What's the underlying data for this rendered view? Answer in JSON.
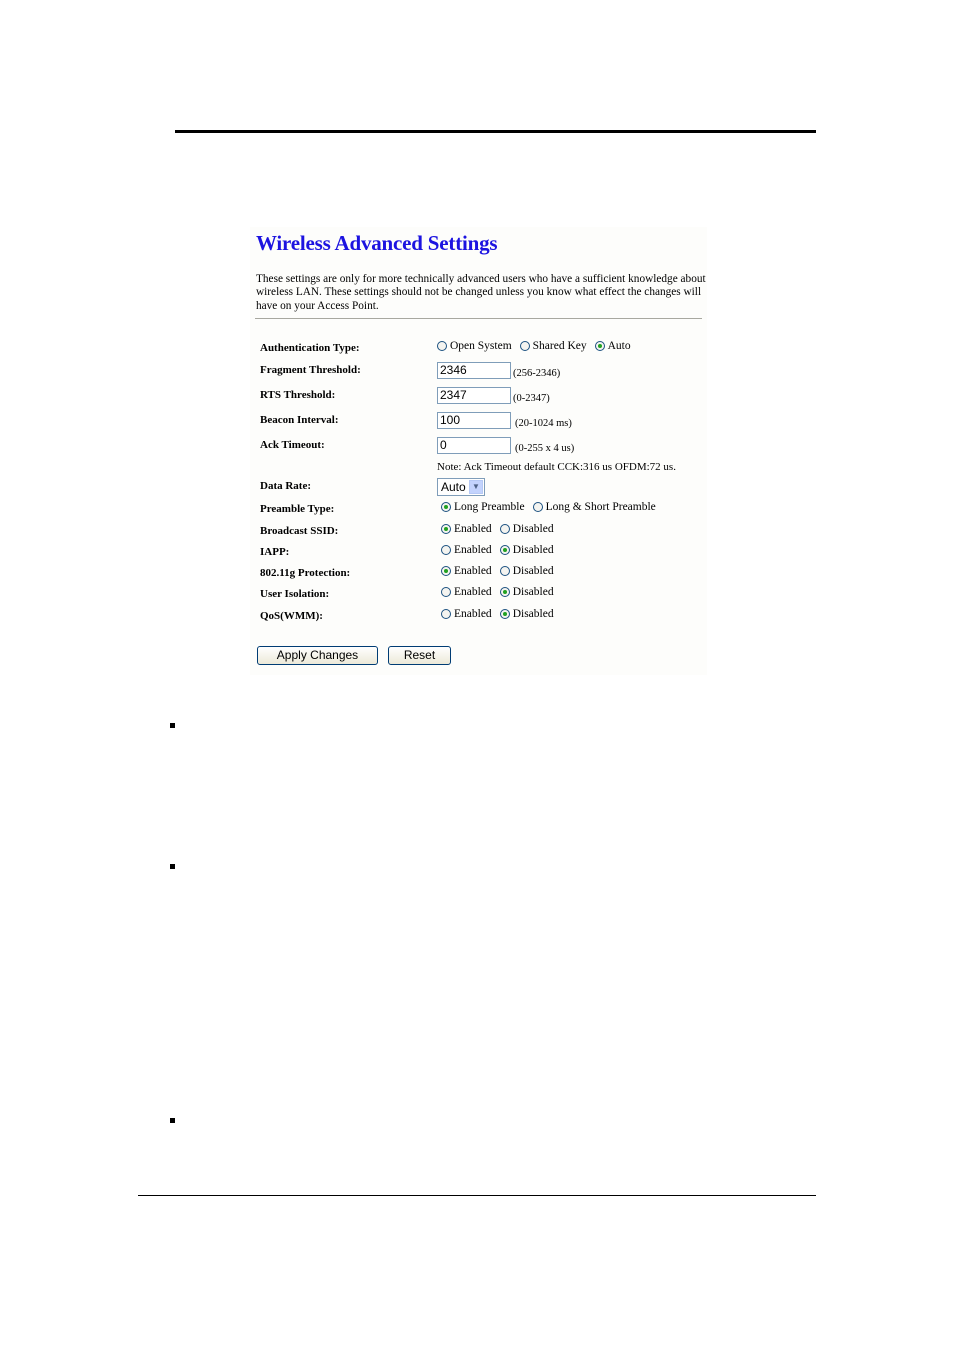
{
  "panel": {
    "title": "Wireless Advanced Settings",
    "intro": "These settings are only for more technically advanced users who have a sufficient knowledge about wireless LAN. These settings should not be changed unless you know what effect the changes will have on your Access Point.",
    "auth": {
      "label": "Authentication Type:",
      "options": [
        "Open System",
        "Shared Key",
        "Auto"
      ],
      "selected": "Auto"
    },
    "fragment": {
      "label": "Fragment Threshold:",
      "value": "2346",
      "hint": "(256-2346)"
    },
    "rts": {
      "label": "RTS Threshold:",
      "value": "2347",
      "hint": "(0-2347)"
    },
    "beacon": {
      "label": "Beacon Interval:",
      "value": "100",
      "hint": "(20-1024 ms)"
    },
    "ack": {
      "label": "Ack Timeout:",
      "value": "0",
      "hint": "(0-255 x 4 us)"
    },
    "ack_note": "Note: Ack Timeout default CCK:316 us OFDM:72 us.",
    "data_rate": {
      "label": "Data Rate:",
      "value": "Auto"
    },
    "preamble": {
      "label": "Preamble Type:",
      "options": [
        "Long Preamble",
        "Long & Short Preamble"
      ],
      "selected": "Long Preamble"
    },
    "broadcast_ssid": {
      "label": "Broadcast SSID:",
      "enabled": "Enabled",
      "disabled": "Disabled",
      "selected": "Enabled"
    },
    "iapp": {
      "label": "IAPP:",
      "enabled": "Enabled",
      "disabled": "Disabled",
      "selected": "Disabled"
    },
    "protection": {
      "label": "802.11g Protection:",
      "enabled": "Enabled",
      "disabled": "Disabled",
      "selected": "Enabled"
    },
    "isolation": {
      "label": "User Isolation:",
      "enabled": "Enabled",
      "disabled": "Disabled",
      "selected": "Disabled"
    },
    "qos": {
      "label": "QoS(WMM):",
      "enabled": "Enabled",
      "disabled": "Disabled",
      "selected": "Disabled"
    },
    "buttons": {
      "apply": "Apply Changes",
      "reset": "Reset"
    }
  },
  "colors": {
    "title": "#1c13e0",
    "radio_selected": "#21a121"
  }
}
